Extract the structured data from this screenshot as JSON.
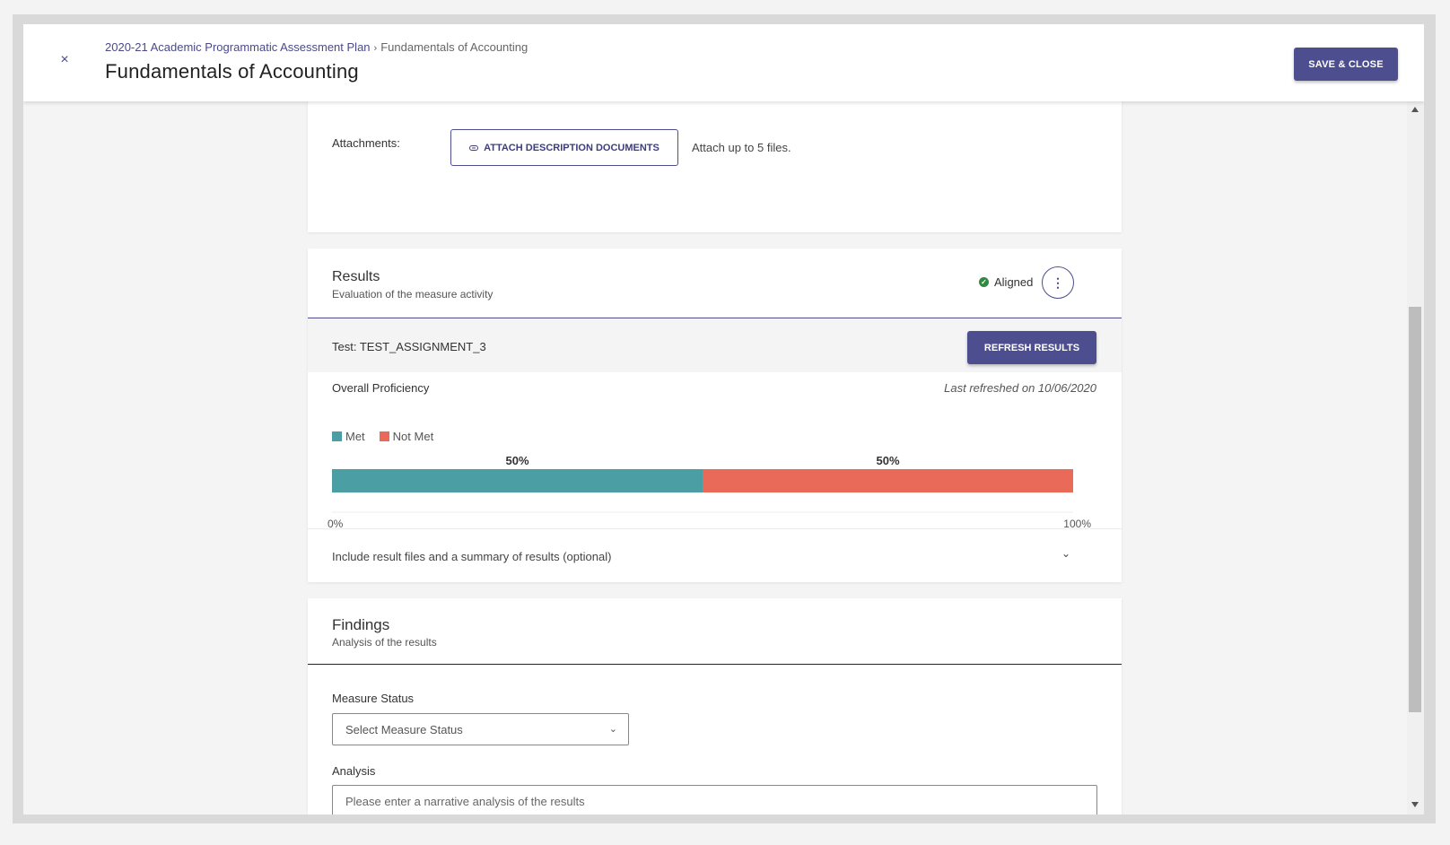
{
  "header": {
    "close_icon": "×",
    "breadcrumb": {
      "parent": "2020-21 Academic Programmatic Assessment Plan",
      "current": "Fundamentals of Accounting"
    },
    "title": "Fundamentals of Accounting",
    "save_label": "SAVE & CLOSE"
  },
  "description_card": {
    "attachments_label": "Attachments:",
    "attach_button_label": "ATTACH DESCRIPTION DOCUMENTS",
    "attach_hint": "Attach up to 5 files."
  },
  "results": {
    "title": "Results",
    "subtitle": "Evaluation of the measure activity",
    "aligned_label": "Aligned",
    "kebab_icon": "⋮",
    "test_label": "Test: TEST_ASSIGNMENT_3",
    "refresh_label": "REFRESH RESULTS",
    "overall_label": "Overall Proficiency",
    "last_refreshed": "Last refreshed on 10/06/2020",
    "include_label": "Include result files and a summary of results (optional)",
    "chevron_icon": "⌄"
  },
  "chart_data": {
    "type": "bar",
    "orientation": "horizontal-stacked",
    "series": [
      {
        "name": "Met",
        "values": [
          50
        ],
        "color": "#4b9fa4",
        "label": "50%"
      },
      {
        "name": "Not Met",
        "values": [
          50
        ],
        "color": "#e96a58",
        "label": "50%"
      }
    ],
    "xlim": [
      0,
      100
    ],
    "x_tick_labels": [
      "0%",
      "100%"
    ],
    "legend_placement": "top-left"
  },
  "findings": {
    "title": "Findings",
    "subtitle": "Analysis of the results",
    "measure_status_label": "Measure Status",
    "measure_status_placeholder": "Select Measure Status",
    "analysis_label": "Analysis",
    "analysis_placeholder": "Please enter a narrative analysis of the results"
  },
  "colors": {
    "accent": "#4c4e8f",
    "met": "#4b9fa4",
    "not_met": "#e96a58"
  }
}
